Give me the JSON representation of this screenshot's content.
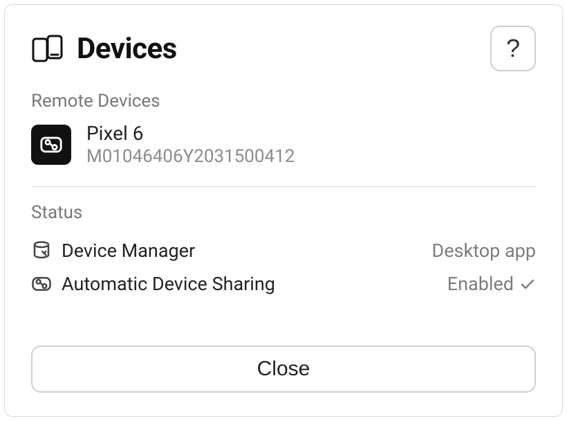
{
  "header": {
    "title": "Devices",
    "help_label": "?"
  },
  "remote_devices": {
    "label": "Remote Devices",
    "items": [
      {
        "name": "Pixel 6",
        "serial": "M01046406Y2031500412"
      }
    ]
  },
  "status": {
    "label": "Status",
    "rows": [
      {
        "name": "Device Manager",
        "value": "Desktop app",
        "checked": false
      },
      {
        "name": "Automatic Device Sharing",
        "value": "Enabled",
        "checked": true
      }
    ]
  },
  "footer": {
    "close_label": "Close"
  }
}
